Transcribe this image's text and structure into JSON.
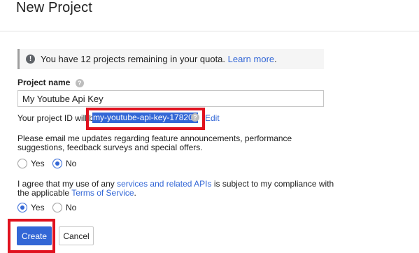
{
  "page": {
    "title": "New Project"
  },
  "quota": {
    "message": "You have 12 projects remaining in your quota.",
    "learn_more": "Learn more",
    "period": "."
  },
  "project_name": {
    "label": "Project name",
    "value": "My Youtube Api Key"
  },
  "project_id": {
    "prefix": "Your project ID will be",
    "value": "my-youtube-api-key-178203",
    "edit_label": "Edit"
  },
  "email_updates": {
    "question_line1": "Please email me updates regarding feature announcements, performance",
    "question_line2": "suggestions, feedback surveys and special offers.",
    "options": [
      "Yes",
      "No"
    ],
    "selected": "No"
  },
  "terms": {
    "line1_a": "I agree that my use of any ",
    "line1_link": "services and related APIs",
    "line1_b": " is subject to my compliance with",
    "line2_a": "the applicable ",
    "line2_link": "Terms of Service",
    "line2_b": ".",
    "options": [
      "Yes",
      "No"
    ],
    "selected": "Yes"
  },
  "actions": {
    "create": "Create",
    "cancel": "Cancel"
  },
  "colors": {
    "accent": "#3367d6",
    "highlight_box": "#e0121f"
  }
}
